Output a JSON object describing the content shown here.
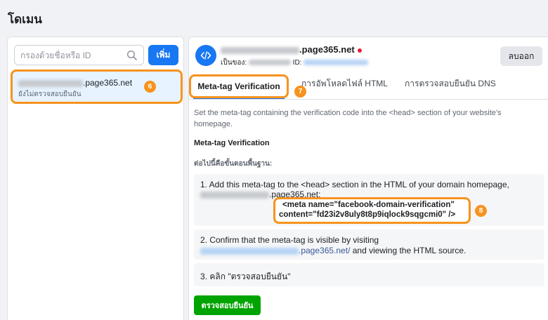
{
  "page": {
    "title": "โดเมน"
  },
  "sidebar": {
    "search_placeholder": "กรองด้วยชื่อหรือ ID",
    "add_label": "เพิ่ม",
    "domain_item": {
      "name_suffix": ".page365.net",
      "status": "ยังไม่ตรวจสอบยืนยัน"
    }
  },
  "header": {
    "domain_suffix": ".page365.net",
    "owner_label": "เป็นของ:",
    "id_label": "ID:",
    "remove_label": "ลบออก"
  },
  "tabs": [
    {
      "label": "Meta-tag Verification",
      "active": true
    },
    {
      "label": "การอัพโหลดไฟล์ HTML",
      "active": false
    },
    {
      "label": "การตรวจสอบยืนยัน DNS",
      "active": false
    }
  ],
  "content": {
    "description": "Set the meta-tag containing the verification code into the <head> section of your website's homepage.",
    "section_title": "Meta-tag Verification",
    "steps_intro": "ต่อไปนี้คือขั้นตอนพื้นฐาน:",
    "step1_line1": "1. Add this meta-tag to the <head> section in the HTML of your domain homepage,",
    "step1_domain_suffix": ".page365.net:",
    "meta_line1": "<meta name=\"facebook-domain-verification\"",
    "meta_line2": "content=\"fd23i2v8uly8t8p9iqlock9sqgcmi0\" />",
    "step2_line1": "2. Confirm that the meta-tag is visible by visiting",
    "step2_link_suffix": ".page365.net/",
    "step2_after": " and viewing the HTML source.",
    "step3": "3. คลิก \"ตรวจสอบยืนยัน\"",
    "verify_label": "ตรวจสอบยืนยัน"
  },
  "badges": {
    "b6": "6",
    "b7": "7",
    "b8": "8"
  },
  "colors": {
    "accent": "#1877f2",
    "highlight": "#f7931e",
    "verify": "#00a400",
    "status_dot": "#e41e3f"
  }
}
